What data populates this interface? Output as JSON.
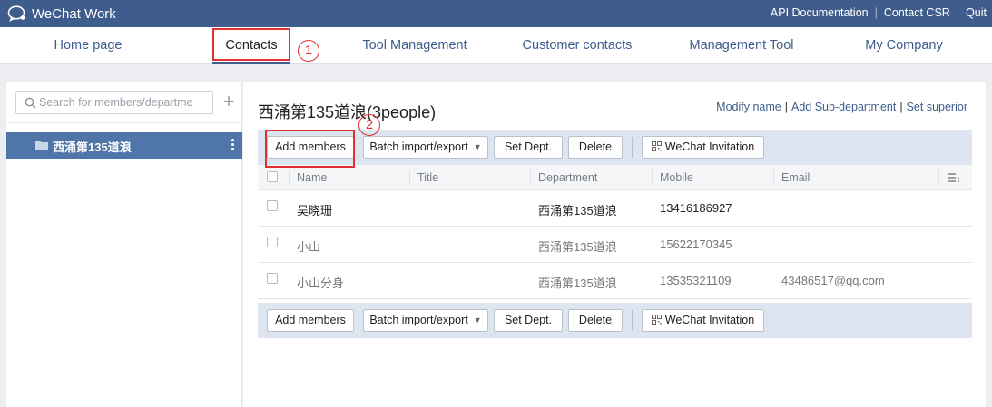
{
  "app": {
    "title": "WeChat Work"
  },
  "top_links": [
    "API Documentation",
    "Contact CSR",
    "Quit"
  ],
  "nav": {
    "items": [
      "Home page",
      "Contacts",
      "Tool Management",
      "Customer contacts",
      "Management Tool",
      "My Company"
    ],
    "active": "Contacts"
  },
  "annotations": {
    "step1": "1",
    "step2": "2"
  },
  "sidebar": {
    "search_placeholder": "Search for members/departme",
    "add_label": "+",
    "department": "西涌第135道浪"
  },
  "main": {
    "title": "西涌第135道浪(3people)",
    "actions": [
      "Modify name",
      "Add Sub-department",
      "Set superior"
    ]
  },
  "toolbar": {
    "add_members": "Add members",
    "batch": "Batch import/export",
    "set_dept": "Set Dept.",
    "delete": "Delete",
    "invite": "WeChat Invitation"
  },
  "table": {
    "columns": [
      "Name",
      "Title",
      "Department",
      "Mobile",
      "Email"
    ],
    "rows": [
      {
        "name": "吴晓珊",
        "title": "",
        "department": "西涌第135道浪",
        "mobile": "13416186927",
        "email": ""
      },
      {
        "name": "小山",
        "title": "",
        "department": "西涌第135道浪",
        "mobile": "15622170345",
        "email": ""
      },
      {
        "name": "小山分身",
        "title": "",
        "department": "西涌第135道浪",
        "mobile": "13535321109",
        "email": "43486517@qq.com"
      }
    ]
  },
  "colors": {
    "brand": "#3e5d8c",
    "selected": "#5075a8",
    "annotation": "#e03030"
  }
}
